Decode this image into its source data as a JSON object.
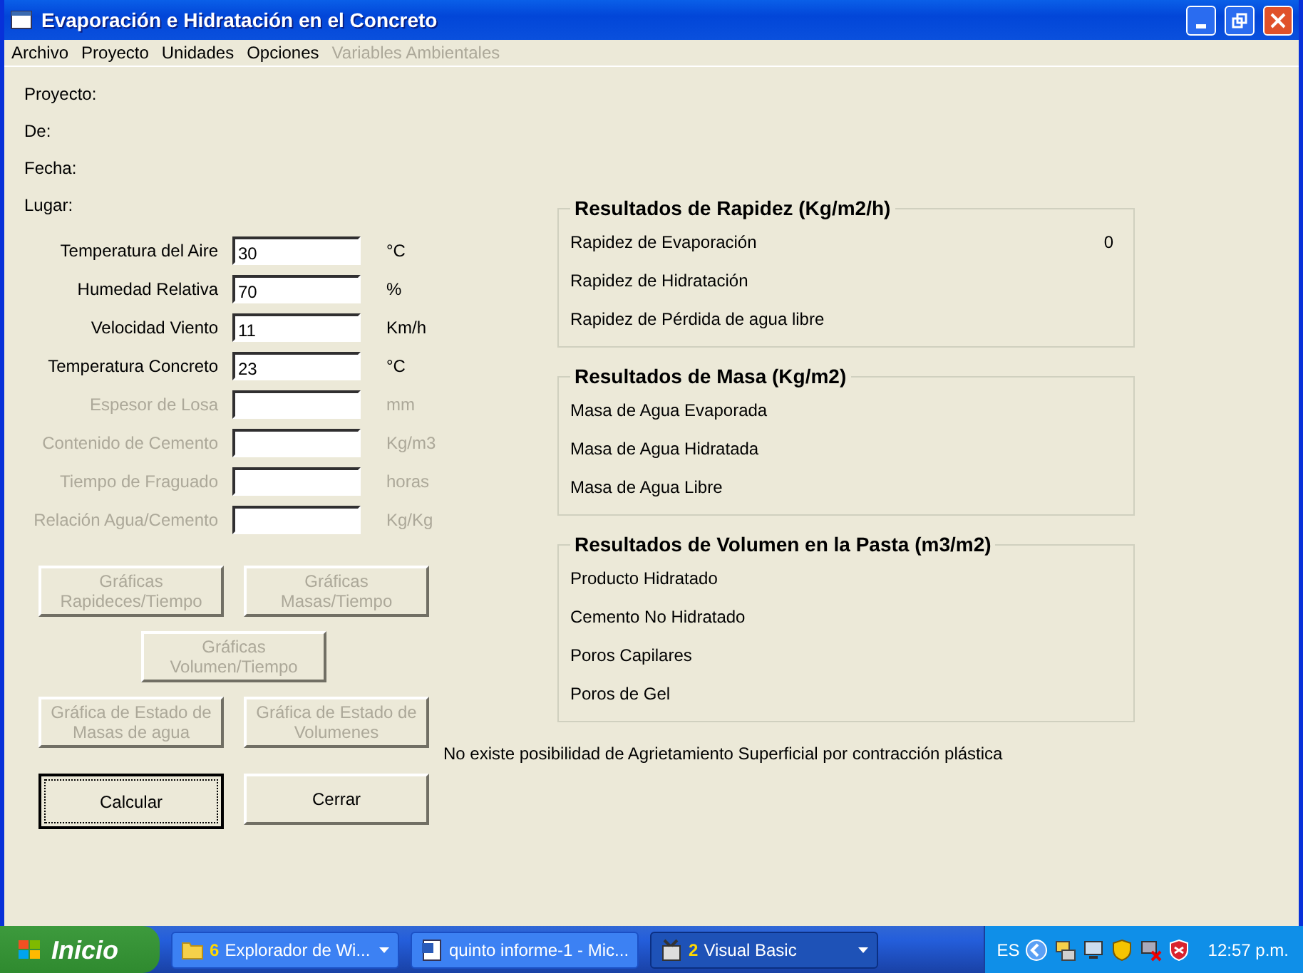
{
  "window": {
    "title": "Evaporación e Hidratación en el Concreto"
  },
  "menu": [
    {
      "label": "Archivo",
      "disabled": false
    },
    {
      "label": "Proyecto",
      "disabled": false
    },
    {
      "label": "Unidades",
      "disabled": false
    },
    {
      "label": "Opciones",
      "disabled": false
    },
    {
      "label": "Variables Ambientales",
      "disabled": true
    }
  ],
  "project_info": [
    {
      "label": "Proyecto:"
    },
    {
      "label": "De:"
    },
    {
      "label": "Fecha:"
    },
    {
      "label": "Lugar:"
    }
  ],
  "inputs": [
    {
      "label": "Temperatura del Aire",
      "value": "30",
      "unit": "°C",
      "disabled": false
    },
    {
      "label": "Humedad Relativa",
      "value": "70",
      "unit": "%",
      "disabled": false
    },
    {
      "label": "Velocidad Viento",
      "value": "11",
      "unit": "Km/h",
      "disabled": false
    },
    {
      "label": "Temperatura Concreto",
      "value": "23",
      "unit": "°C",
      "disabled": false
    },
    {
      "label": "Espesor de Losa",
      "unit": "mm",
      "disabled": true
    },
    {
      "label": "Contenido de Cemento",
      "unit": "Kg/m3",
      "disabled": true
    },
    {
      "label": "Tiempo de Fraguado",
      "unit": "horas",
      "disabled": true
    },
    {
      "label": "Relación Agua/Cemento",
      "unit": "Kg/Kg",
      "disabled": true
    }
  ],
  "button_rows": [
    [
      {
        "label": "Gráficas\nRapideces/Tiempo",
        "disabled": true,
        "focused": false
      },
      {
        "label": "Gráficas\nMasas/Tiempo",
        "disabled": true,
        "focused": false
      }
    ],
    [
      {
        "label": "Gráficas\nVolumen/Tiempo",
        "disabled": true,
        "focused": false
      }
    ],
    [
      {
        "label": "Gráfica de Estado de\nMasas de agua",
        "disabled": true,
        "focused": false
      },
      {
        "label": "Gráfica de Estado de\nVolumenes",
        "disabled": true,
        "focused": false
      }
    ],
    [
      {
        "label": "Calcular",
        "disabled": false,
        "focused": true
      },
      {
        "label": "Cerrar",
        "disabled": false,
        "focused": false
      }
    ]
  ],
  "groups": [
    {
      "title": "Resultados de Rapidez (Kg/m2/h)",
      "items": [
        {
          "label": "Rapidez de Evaporación",
          "value": "0"
        },
        {
          "label": "Rapidez de Hidratación"
        },
        {
          "label": "Rapidez de Pérdida de agua libre"
        }
      ]
    },
    {
      "title": "Resultados de Masa (Kg/m2)",
      "items": [
        {
          "label": "Masa de Agua Evaporada"
        },
        {
          "label": "Masa de Agua Hidratada"
        },
        {
          "label": "Masa de Agua Libre"
        }
      ]
    },
    {
      "title": "Resultados de Volumen en la Pasta (m3/m2)",
      "items": [
        {
          "label": "Producto Hidratado"
        },
        {
          "label": "Cemento No Hidratado"
        },
        {
          "label": "Poros Capilares"
        },
        {
          "label": "Poros de Gel"
        }
      ]
    }
  ],
  "message": "No existe posibilidad de Agrietamiento Superficial por contracción plástica",
  "taskbar": {
    "start": "Inicio",
    "tasks": [
      {
        "count": "6",
        "label": "Explorador de Wi...",
        "kind": "folder",
        "selected": false,
        "menu": true
      },
      {
        "label": "quinto informe-1 - Mic...",
        "kind": "document",
        "selected": false,
        "menu": false
      },
      {
        "count": "2",
        "label": "Visual Basic",
        "kind": "app",
        "selected": true,
        "menu": true
      }
    ],
    "language": "ES",
    "clock": "12:57 p.m."
  }
}
